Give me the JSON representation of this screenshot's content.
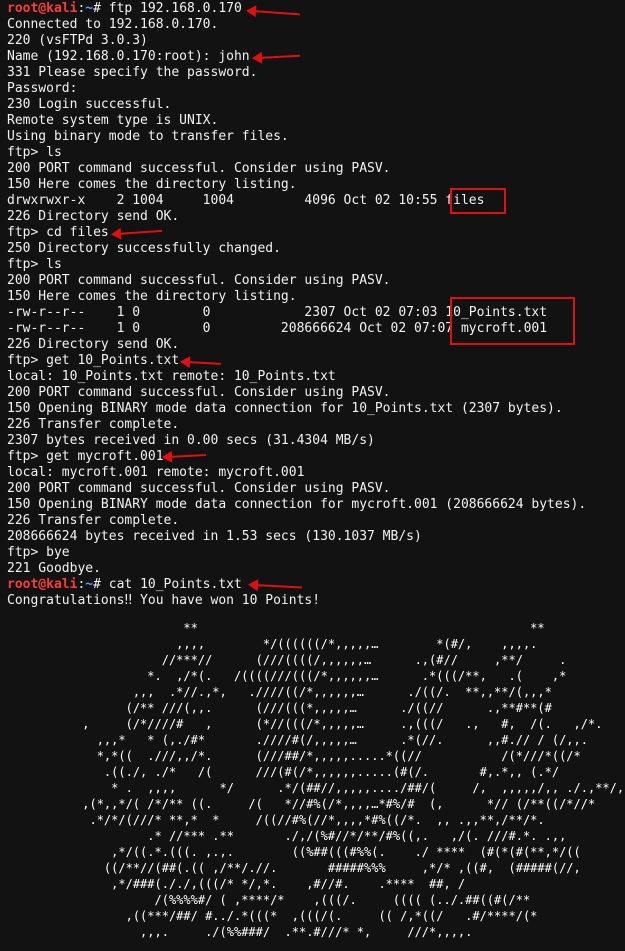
{
  "terminal": {
    "prompt_user": "root@kali",
    "prompt_sep": ":",
    "prompt_path": "~",
    "prompt_hash": "# ",
    "cmd_ftp": "ftp 192.168.0.170",
    "out_connected": "Connected to 192.168.0.170.",
    "out_220": "220 (vsFTPd 3.0.3)",
    "out_name": "Name (192.168.0.170:root): john",
    "out_331": "331 Please specify the password.",
    "out_password": "Password:",
    "out_230": "230 Login successful.",
    "out_remote": "Remote system type is UNIX.",
    "out_binary": "Using binary mode to transfer files.",
    "ftp_ls_1": "ftp> ls",
    "out_port_1": "200 PORT command successful. Consider using PASV.",
    "out_150_dir_1": "150 Here comes the directory listing.",
    "listing_files_meta": "drwxrwxr-x    2 1004     1004         4096 Oct 02 10:55 ",
    "listing_files_name": "files",
    "out_226_dir_1": "226 Directory send OK.",
    "ftp_cd": "ftp> cd files",
    "out_250": "250 Directory successfully changed.",
    "ftp_ls_2": "ftp> ls",
    "out_port_2": "200 PORT command successful. Consider using PASV.",
    "out_150_dir_2": "150 Here comes the directory listing.",
    "listing_points_meta": "-rw-r--r--    1 0        0            2307 Oct 02 07:03 ",
    "listing_points_name": "10_Points.txt",
    "listing_mycroft_meta": "-rw-r--r--    1 0        0         208666624 Oct 02 07:07 ",
    "listing_mycroft_name": "mycroft.001",
    "out_226_dir_2": "226 Directory send OK.",
    "ftp_get_points": "ftp> get 10_Points.txt",
    "out_local_points": "local: 10_Points.txt remote: 10_Points.txt",
    "out_port_3": "200 PORT command successful. Consider using PASV.",
    "out_150_points": "150 Opening BINARY mode data connection for 10_Points.txt (2307 bytes).",
    "out_226_points": "226 Transfer complete.",
    "out_bytes_points": "2307 bytes received in 0.00 secs (31.4304 MB/s)",
    "ftp_get_mycroft": "ftp> get mycroft.001",
    "out_local_mycroft": "local: mycroft.001 remote: mycroft.001",
    "out_port_4": "200 PORT command successful. Consider using PASV.",
    "out_150_mycroft": "150 Opening BINARY mode data connection for mycroft.001 (208666624 bytes).",
    "out_226_mycroft": "226 Transfer complete.",
    "out_bytes_mycroft": "208666624 bytes received in 1.53 secs (130.1037 MB/s)",
    "ftp_bye": "ftp> bye",
    "out_221": "221 Goodbye.",
    "cmd_cat": "cat 10_Points.txt",
    "out_congrats": "Congratulations‼ You have won 10 Points!"
  },
  "ascii_art": [
    "                        **                                              **",
    "                       ,,,,        */((((((/*,,,,,…        *(#/,    ,,,,.",
    "                     //***//      (///((((/,,,,,,…      .,(#//     ,**/     .",
    "                   *.  ,/*(.   /((((///(((/*,,,,,,…      .*(((/**,   .(    ,*",
    "                 ,,,  .*//.,*,   .////((/*,,,,,,…      ./((/.  **,,**/(,,,*",
    "                (/** ///(,,.      (///(((*,,,,,…      ./((//      .,**#**(#",
    "          ,     (/*////#   ,      (*//(((/*,,,,,…     .,(((/   .,   #,  /(.   ,/*.",
    "            ,,,*   * (,./#*       .////#(/,,,,,…      .*(//.      ,,#.// / (/,,.",
    "            *,*((  .///,,/*.      (///##/*,,,,,.....*((//           /(*///*((/*",
    "             .((./, ./*   /(      ///(#(/*,,,,,,.....(#(/.       #,.*,, (.*/",
    "              * .  ,,,,      */      .*/(##//,,,,,..../##/(     /,  ,,,,,/,, ./.,**/,",
    "          ,(*,,*/( /*/** ((.     /(   *//#%(/*,,,,…*#%/#  (,      *// (/**((/*//*",
    "           .*/*/(///* **,*  *     /((//#%(//*,,,,*#%((/*.  ,, .,,**,/**/*.",
    "                   .* //*** .**       ./,/(%#//*/**/#%((,.   ,/(. ///#.*. .,,",
    "              ,*/((.*.(((. ,.,.        ((%##(((#%%(.    ./ ****  (#(*(#(**,*/((",
    "             ((/**//(##(.(( ,/**/.//.       #####%%%     ,*/* ,((#,  (#####(//,",
    "              ,*/###(././,(((/* */,*.    ,#//#.    .****  ##, /",
    "                    /(%%%%#/ ( ,****/*    ,(((/.     (((( (../.##((#(/**",
    "                ,((***/##/ #../.*(((*  ,(((/(.     (( /,*((/   .#/****/(*",
    "                  ,,,.     ./(%%###/  .**.#///* *,     ///*,,,,."
  ]
}
